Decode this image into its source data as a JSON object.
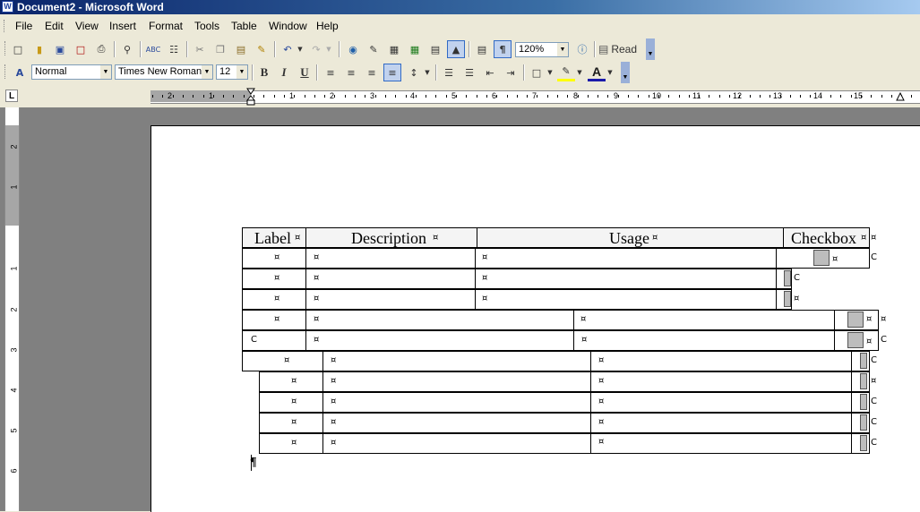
{
  "window": {
    "title": "Document2 - Microsoft Word",
    "icon": "word-icon"
  },
  "menu": [
    "File",
    "Edit",
    "View",
    "Insert",
    "Format",
    "Tools",
    "Table",
    "Window",
    "Help"
  ],
  "standard_toolbar": {
    "zoom": "120%",
    "read_label": "Read"
  },
  "formatting_toolbar": {
    "style": "Normal",
    "font": "Times New Roman",
    "size": "12"
  },
  "ruler": {
    "h_numbers": [
      "2",
      "1",
      "1",
      "2",
      "3",
      "4",
      "5",
      "6",
      "7",
      "8",
      "9",
      "10",
      "11",
      "12",
      "13",
      "14",
      "15"
    ],
    "v_numbers": [
      "2",
      "1",
      "1",
      "2",
      "3",
      "4",
      "5",
      "6"
    ]
  },
  "table": {
    "headers": [
      "Label",
      "Description",
      "Usage",
      "Checkbox"
    ],
    "cell_mark": "¤",
    "end_mark": "C"
  },
  "paragraph_mark": "¶"
}
